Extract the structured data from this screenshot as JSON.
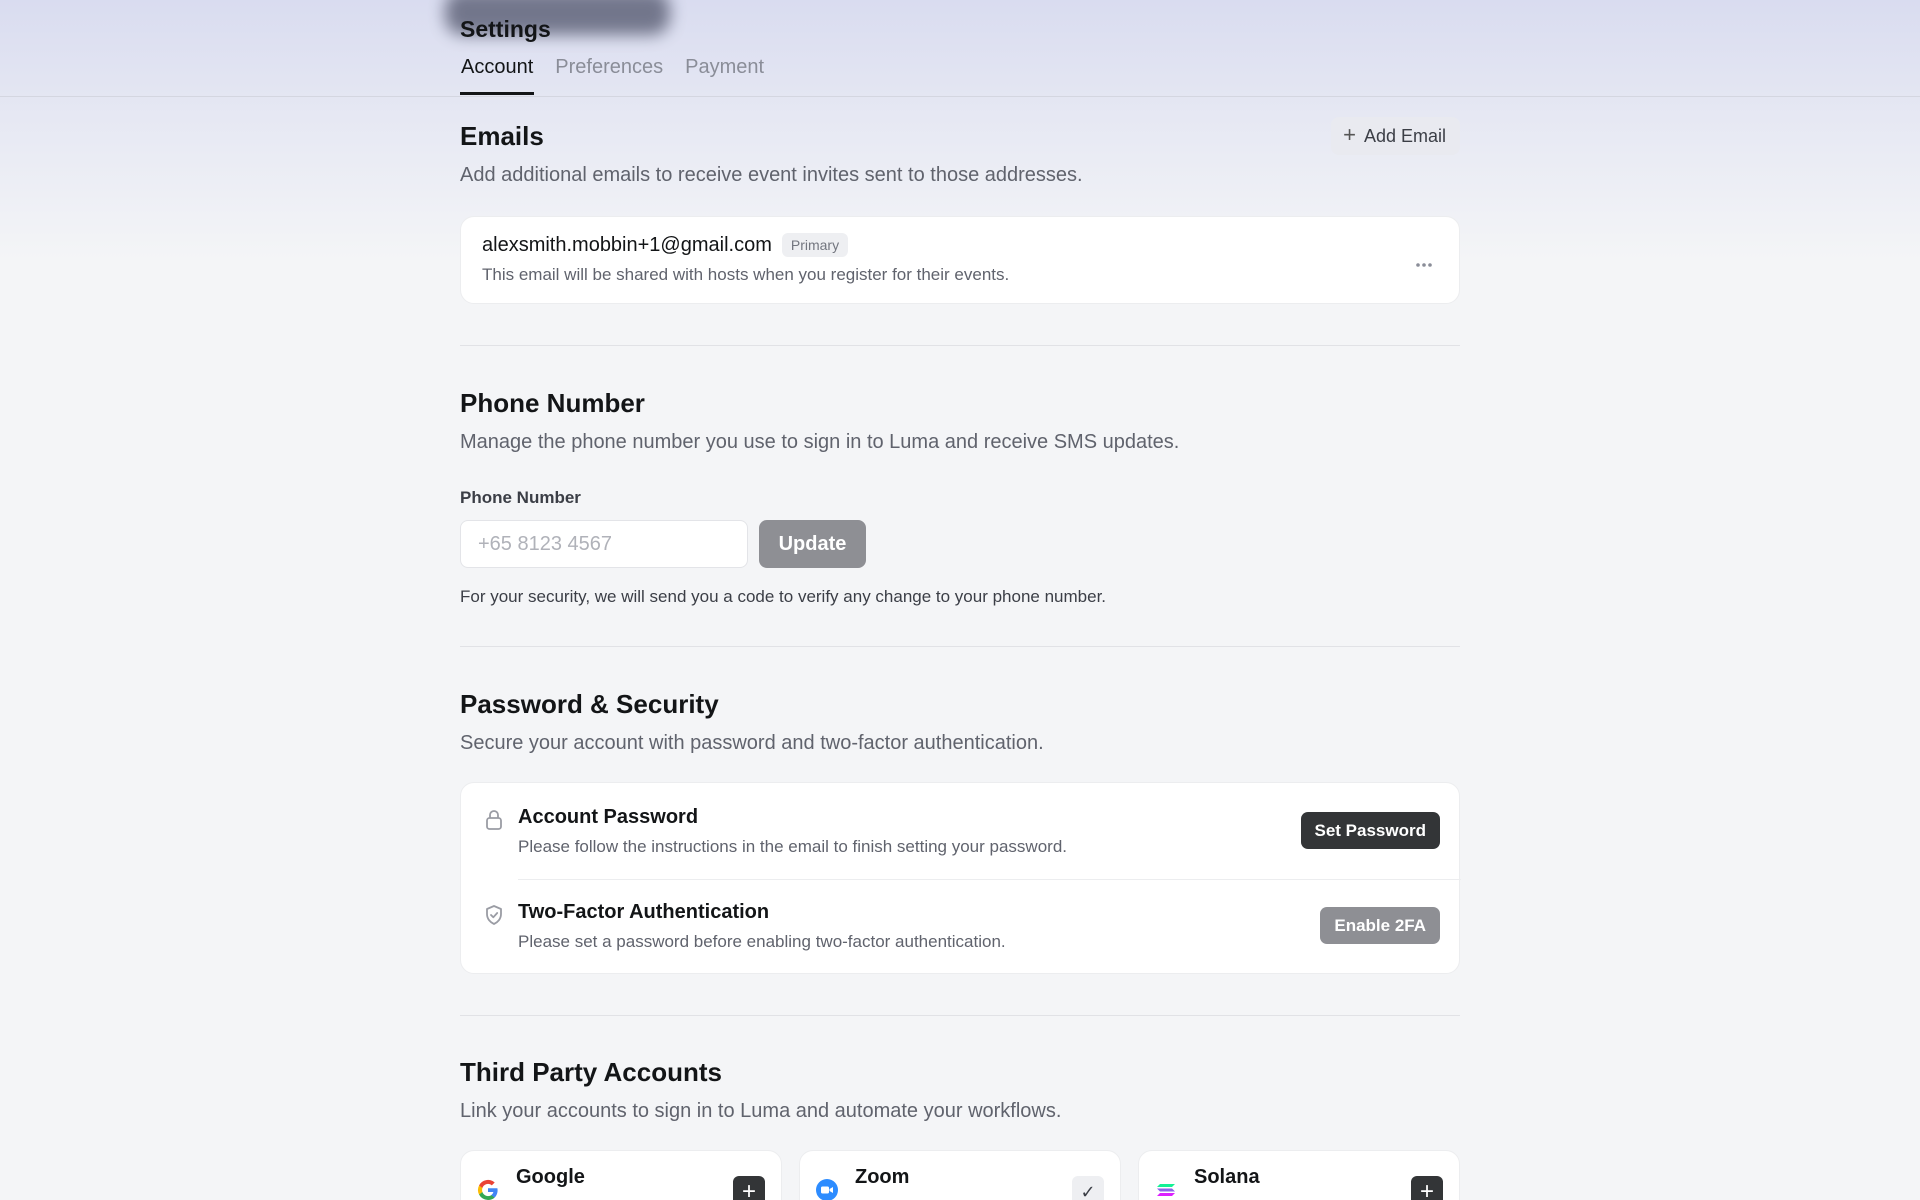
{
  "header": {
    "title": "Settings",
    "tabs": [
      {
        "label": "Account",
        "active": true
      },
      {
        "label": "Preferences",
        "active": false
      },
      {
        "label": "Payment",
        "active": false
      }
    ]
  },
  "emails": {
    "title": "Emails",
    "description": "Add additional emails to receive event invites sent to those addresses.",
    "add_button": "Add Email",
    "items": [
      {
        "address": "alexsmith.mobbin+1@gmail.com",
        "badge": "Primary",
        "note": "This email will be shared with hosts when you register for their events."
      }
    ]
  },
  "phone": {
    "title": "Phone Number",
    "description": "Manage the phone number you use to sign in to Luma and receive SMS updates.",
    "field_label": "Phone Number",
    "placeholder": "+65 8123 4567",
    "update_button": "Update",
    "note": "For your security, we will send you a code to verify any change to your phone number."
  },
  "security": {
    "title": "Password & Security",
    "description": "Secure your account with password and two-factor authentication.",
    "rows": [
      {
        "icon": "lock-icon",
        "title": "Account Password",
        "description": "Please follow the instructions in the email to finish setting your password.",
        "button": "Set Password"
      },
      {
        "icon": "shield-icon",
        "title": "Two-Factor Authentication",
        "description": "Please set a password before enabling two-factor authentication.",
        "button": "Enable 2FA"
      }
    ]
  },
  "third_party": {
    "title": "Third Party Accounts",
    "description": "Link your accounts to sign in to Luma and automate your workflows.",
    "accounts": [
      {
        "name": "Google",
        "icon": "google-icon",
        "action": "add"
      },
      {
        "name": "Zoom",
        "icon": "zoom-icon",
        "action": "connected"
      },
      {
        "name": "Solana",
        "icon": "solana-icon",
        "action": "add"
      }
    ]
  }
}
